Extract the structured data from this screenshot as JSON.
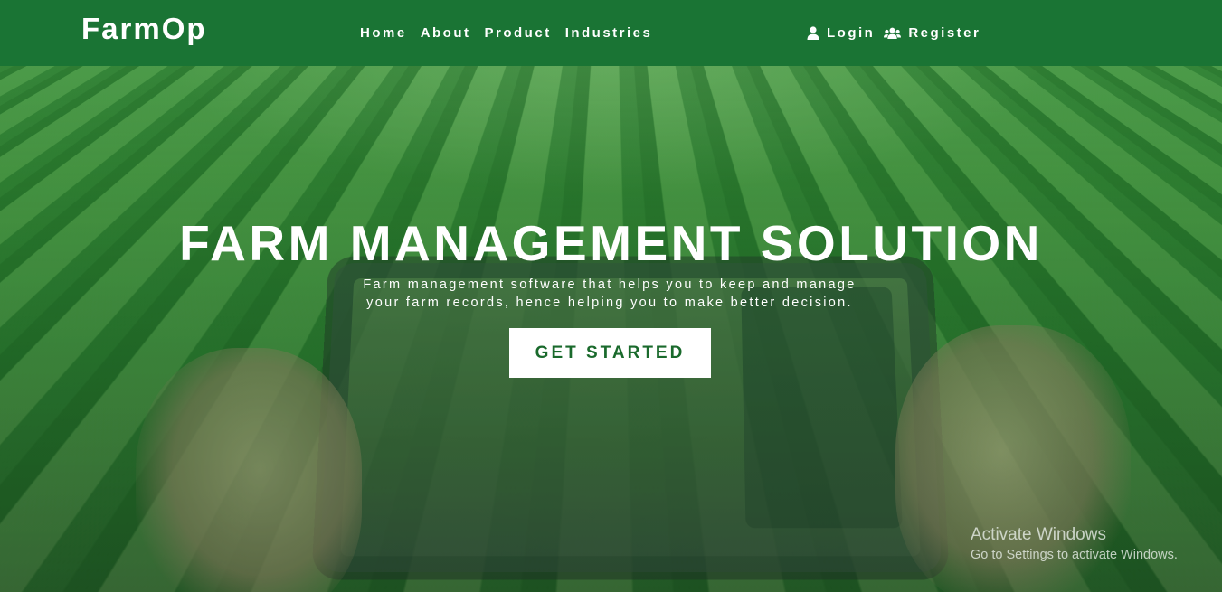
{
  "brand": {
    "name": "FarmOp"
  },
  "nav": {
    "links": [
      "Home",
      "About",
      "Product",
      "Industries"
    ]
  },
  "auth": {
    "login_label": "Login",
    "login_icon": "user-icon",
    "register_label": "Register",
    "register_icon": "users-icon"
  },
  "hero": {
    "title": "FARM MANAGEMENT SOLUTION",
    "subtitle_line1": "Farm management software that helps you to keep and manage",
    "subtitle_line2": "your farm records, hence helping you to make better decision.",
    "cta_label": "GET STARTED"
  },
  "windows_notice": {
    "title": "Activate Windows",
    "subtitle": "Go to Settings to activate Windows."
  },
  "colors": {
    "navbar": "#1a7434",
    "cta_text": "#1a6a2c",
    "cta_background": "#ffffff"
  }
}
